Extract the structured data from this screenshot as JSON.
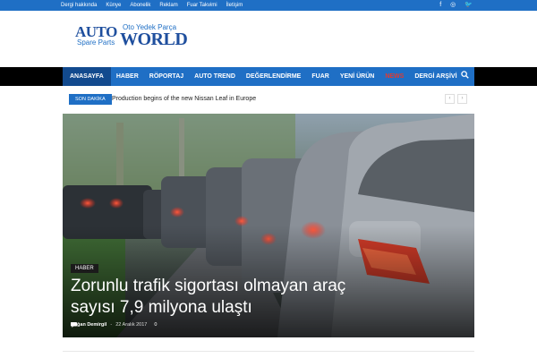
{
  "topbar": {
    "links": [
      "Dergi hakkında",
      "Künye",
      "Abonelik",
      "Reklam",
      "Fuar Takvimi",
      "İletişim"
    ],
    "social": [
      {
        "icon": "facebook-icon",
        "glyph": "f"
      },
      {
        "icon": "instagram-icon",
        "glyph": "◎"
      },
      {
        "icon": "twitter-icon",
        "glyph": "🐦"
      }
    ]
  },
  "logo": {
    "auto": "AUTO",
    "spare": "Spare Parts",
    "oto": "Oto Yedek Parça",
    "world": "WORLD"
  },
  "nav": {
    "items": [
      "ANASAYFA",
      "HABER",
      "RÖPORTAJ",
      "AUTO TREND",
      "DEĞERLENDİRME",
      "FUAR",
      "YENİ ÜRÜN",
      "NEWS",
      "DERGİ ARŞİVİ"
    ],
    "search_icon": "search-icon"
  },
  "ticker": {
    "badge": "SON DAKİKA",
    "headline": "Production begins of the new Nissan Leaf in Europe",
    "prev": "‹",
    "next": "›"
  },
  "hero": {
    "category": "HABER",
    "title": "Zorunlu trafik sigortası olmayan araç sayısı 7,9 milyona ulaştı",
    "author": "Kağan Demirgil",
    "separator": "-",
    "date": "22 Aralık 2017",
    "comment_count": "0"
  },
  "colors": {
    "brand_blue": "#1f6fc5",
    "nav_active": "#124a8e",
    "news_red": "#e23b2f"
  }
}
